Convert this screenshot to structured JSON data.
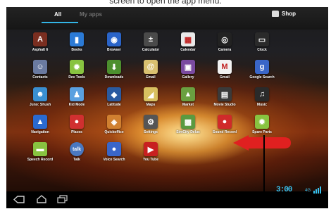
{
  "caption": "screen to open the app menu.",
  "tabs": {
    "all": "All",
    "my_apps": "My apps"
  },
  "shop": {
    "label": "Shop",
    "icon": "shopping-bag-icon"
  },
  "apps": [
    {
      "label": "Asphalt 6",
      "icon": "asphalt-icon",
      "color": "#7a2e20",
      "glyph": "A"
    },
    {
      "label": "Books",
      "icon": "books-icon",
      "color": "#2b7ad6",
      "glyph": "▮"
    },
    {
      "label": "Browser",
      "icon": "globe-icon",
      "color": "#2a64c8",
      "glyph": "◉"
    },
    {
      "label": "Calculator",
      "icon": "calculator-icon",
      "color": "#4a4a4a",
      "glyph": "±"
    },
    {
      "label": "Calendar",
      "icon": "calendar-icon",
      "color": "#e9e9e9",
      "glyph": "▦"
    },
    {
      "label": "Camera",
      "icon": "camera-icon",
      "color": "#222",
      "glyph": "◎"
    },
    {
      "label": "Clock",
      "icon": "clock-icon",
      "color": "#2a2a2a",
      "glyph": "▭"
    },
    {
      "label": "Contacts",
      "icon": "contacts-icon",
      "color": "#6a7aa0",
      "glyph": "☺"
    },
    {
      "label": "Dev Tools",
      "icon": "dev-tools-icon",
      "color": "#88c340",
      "glyph": "✹"
    },
    {
      "label": "Downloads",
      "icon": "downloads-icon",
      "color": "#4c8f2e",
      "glyph": "⬇"
    },
    {
      "label": "Email",
      "icon": "email-icon",
      "color": "#d9c070",
      "glyph": "@"
    },
    {
      "label": "Gallery",
      "icon": "gallery-icon",
      "color": "#7a4aa0",
      "glyph": "▣"
    },
    {
      "label": "Gmail",
      "icon": "gmail-icon",
      "color": "#f2f2f2",
      "glyph": "M"
    },
    {
      "label": "Google Search",
      "icon": "google-search-icon",
      "color": "#3a66c8",
      "glyph": "g"
    },
    {
      "label": "Juno: Shush",
      "icon": "juno-icon",
      "color": "#3a8fd0",
      "glyph": "☻"
    },
    {
      "label": "Kid Mode",
      "icon": "kid-mode-icon",
      "color": "#5aa0e0",
      "glyph": "♟"
    },
    {
      "label": "Latitude",
      "icon": "latitude-icon",
      "color": "#2a5aa0",
      "glyph": "◆"
    },
    {
      "label": "Maps",
      "icon": "maps-icon",
      "color": "#d8c060",
      "glyph": "◢"
    },
    {
      "label": "Market",
      "icon": "market-icon",
      "color": "#6aa040",
      "glyph": "▲"
    },
    {
      "label": "Movie Studio",
      "icon": "movie-studio-icon",
      "color": "#3a3a3a",
      "glyph": "▤"
    },
    {
      "label": "Music",
      "icon": "music-icon",
      "color": "#2a2a2a",
      "glyph": "♫"
    },
    {
      "label": "Navigation",
      "icon": "navigation-icon",
      "color": "#2a6ad0",
      "glyph": "▲"
    },
    {
      "label": "Places",
      "icon": "places-icon",
      "color": "#d03030",
      "glyph": "●"
    },
    {
      "label": "Quickoffice",
      "icon": "quickoffice-icon",
      "color": "#d08030",
      "glyph": "◈"
    },
    {
      "label": "Settings",
      "icon": "settings-icon",
      "color": "#555",
      "glyph": "⚙"
    },
    {
      "label": "SimCity Delux",
      "icon": "simcity-icon",
      "color": "#5a9a40",
      "glyph": "▩"
    },
    {
      "label": "Sound Record",
      "icon": "sound-record-icon",
      "color": "#d02a2a",
      "glyph": "●"
    },
    {
      "label": "Spare Parts",
      "icon": "spare-parts-icon",
      "color": "#88c340",
      "glyph": "✹"
    },
    {
      "label": "Speech Record",
      "icon": "speech-record-icon",
      "color": "#88c340",
      "glyph": "▬"
    },
    {
      "label": "Talk",
      "icon": "talk-icon",
      "color": "#4a78c0",
      "glyph": "talk"
    },
    {
      "label": "Voice Search",
      "icon": "voice-search-icon",
      "color": "#3a66c8",
      "glyph": "●"
    },
    {
      "label": "You Tube",
      "icon": "youtube-icon",
      "color": "#c82020",
      "glyph": "▶"
    }
  ],
  "navbar": {
    "back_icon": "back-icon",
    "home_icon": "home-icon",
    "recent_icon": "recent-apps-icon",
    "clock": "3:00",
    "signal": "4G"
  },
  "colors": {
    "accent": "#33b5e5",
    "callout": "#e02020"
  }
}
